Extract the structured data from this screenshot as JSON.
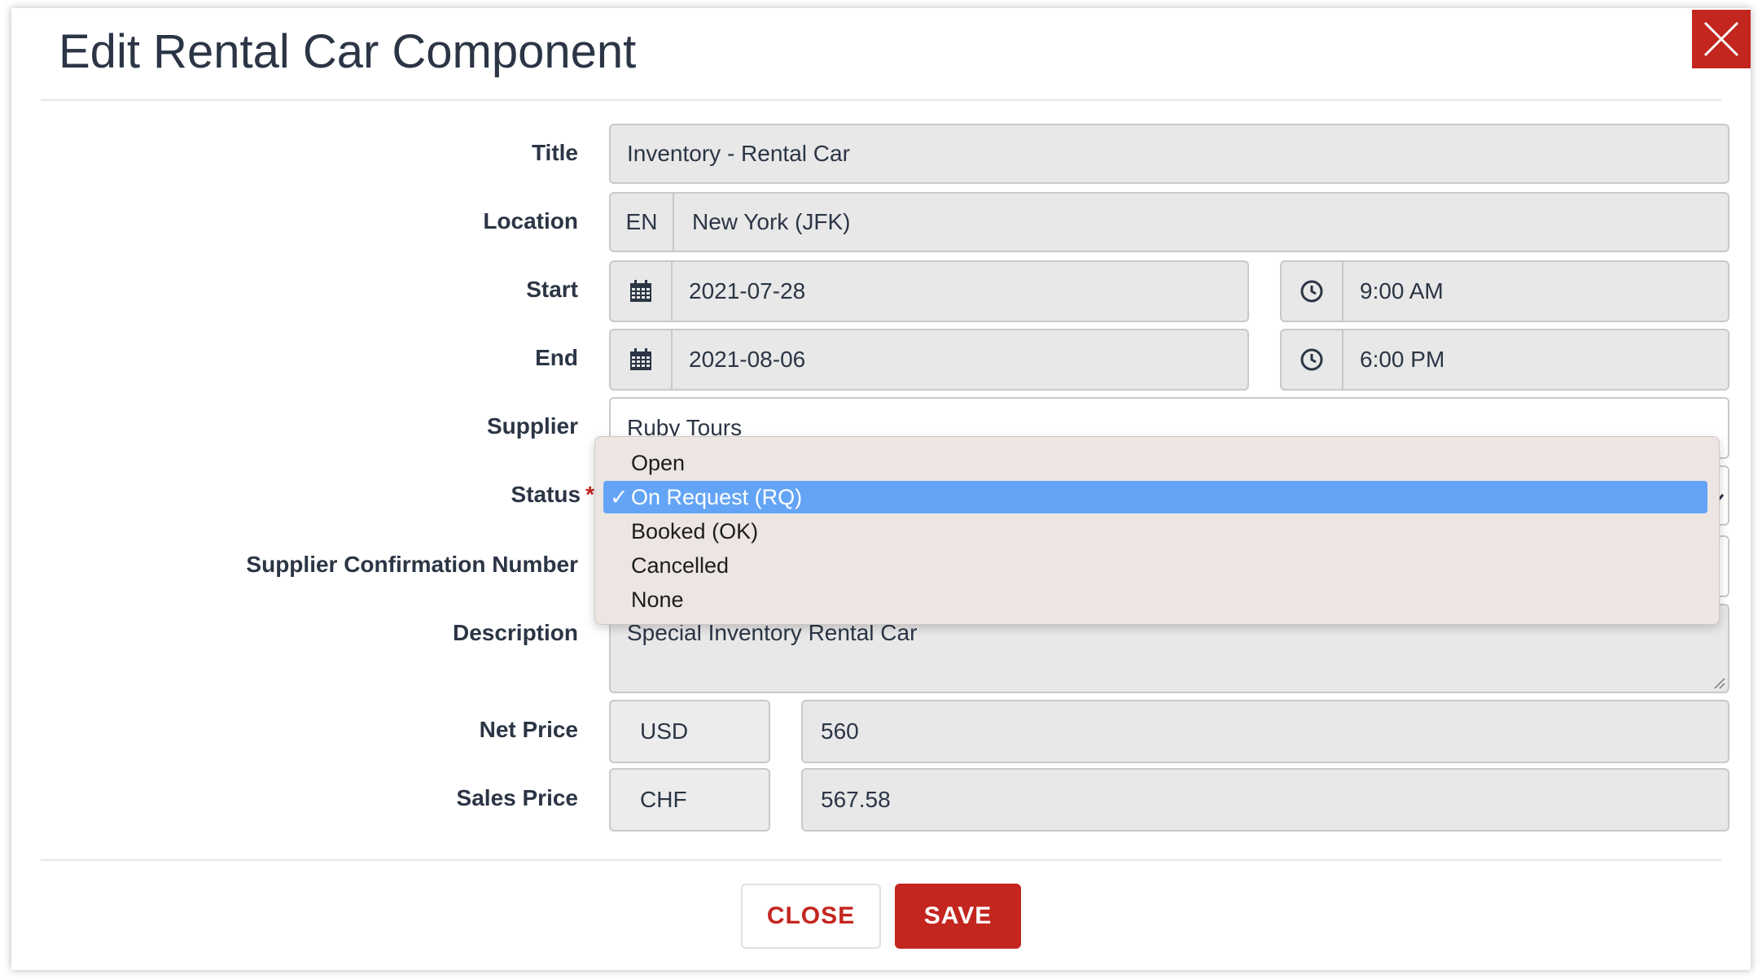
{
  "modal": {
    "title": "Edit Rental Car Component"
  },
  "form": {
    "title": {
      "label": "Title",
      "value": "Inventory - Rental Car"
    },
    "location": {
      "label": "Location",
      "lang": "EN",
      "value": "New York (JFK)"
    },
    "start": {
      "label": "Start",
      "date": "2021-07-28",
      "time": "9:00 AM"
    },
    "end": {
      "label": "End",
      "date": "2021-08-06",
      "time": "6:00 PM"
    },
    "supplier": {
      "label": "Supplier",
      "value": "Ruby Tours"
    },
    "status": {
      "label": "Status",
      "required_marker": "*",
      "check": "✓",
      "selected": "On Request (RQ)",
      "options": [
        "Open",
        "On Request (RQ)",
        "Booked (OK)",
        "Cancelled",
        "None"
      ]
    },
    "confirmation": {
      "label": "Supplier Confirmation Number",
      "value": ""
    },
    "description": {
      "label": "Description",
      "value": "Special Inventory Rental Car"
    },
    "net_price": {
      "label": "Net Price",
      "currency": "USD",
      "value": "560"
    },
    "sales_price": {
      "label": "Sales Price",
      "currency": "CHF",
      "value": "567.58"
    }
  },
  "footer": {
    "close_label": "CLOSE",
    "save_label": "SAVE"
  },
  "colors": {
    "accent": "#c3261f",
    "selection": "#64a4f6",
    "field_bg": "#e8e8e8",
    "text": "#2b3545"
  },
  "icons": {
    "close": "close-icon",
    "calendar": "calendar-icon",
    "clock": "clock-icon",
    "resize": "resize-handle-icon"
  }
}
